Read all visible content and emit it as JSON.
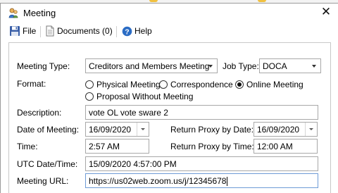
{
  "window": {
    "title": "Meeting",
    "close_symbol": "✕"
  },
  "toolbar": {
    "file_label": "File",
    "documents_label": "Documents (0)",
    "help_label": "Help"
  },
  "form": {
    "meeting_type_label": "Meeting Type:",
    "meeting_type_value": "Creditors and Members Meeting",
    "job_type_label": "Job Type:",
    "job_type_value": "DOCA",
    "format_label": "Format:",
    "format_options": [
      {
        "label": "Physical Meeting",
        "selected": false
      },
      {
        "label": "Correspondence",
        "selected": false
      },
      {
        "label": "Online Meeting",
        "selected": true
      },
      {
        "label": "Proposal Without Meeting",
        "selected": false
      }
    ],
    "description_label": "Description:",
    "description_value": "vote OL vote sware 2",
    "date_label": "Date of Meeting:",
    "date_value": "16/09/2020",
    "return_proxy_date_label": "Return Proxy by Date:",
    "return_proxy_date_value": "16/09/2020",
    "time_label": "Time:",
    "time_value": "2:57 AM",
    "return_proxy_time_label": "Return Proxy by Time:",
    "return_proxy_time_value": "12:00 AM",
    "utc_label": "UTC Date/Time:",
    "utc_value": "15/09/2020 4:57:00 PM",
    "url_label": "Meeting URL:",
    "url_value": "https://us02web.zoom.us/j/12345678"
  },
  "colors": {
    "accent_help": "#2b6cc4",
    "save_icon": "#3a5fa8",
    "title_icon": "#3d7bd1"
  }
}
